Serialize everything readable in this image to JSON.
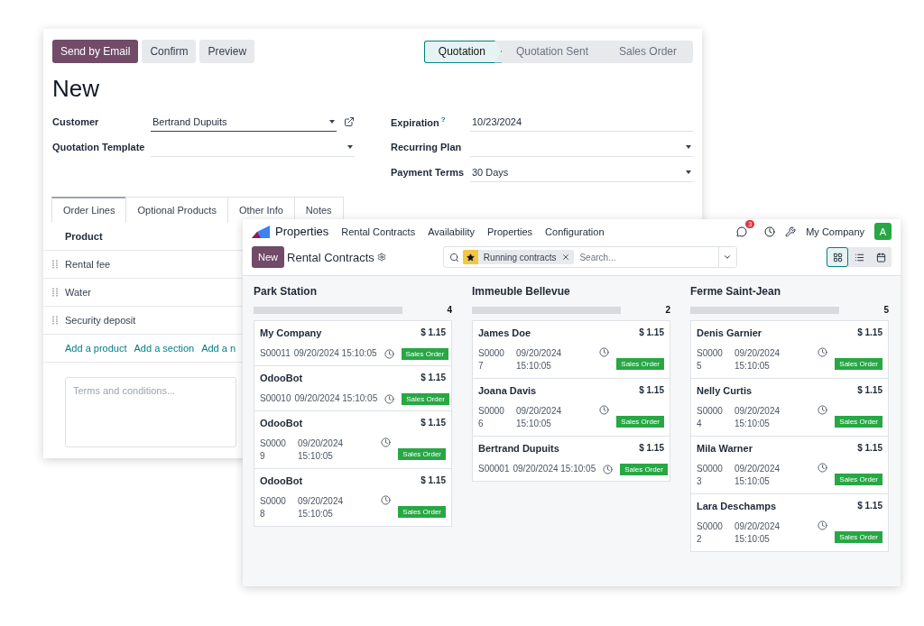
{
  "quotation_window": {
    "actions": [
      "Send by Email",
      "Confirm",
      "Preview"
    ],
    "stages": [
      {
        "label": "Quotation",
        "selected": true
      },
      {
        "label": "Quotation Sent",
        "selected": false
      },
      {
        "label": "Sales Order",
        "selected": false
      }
    ],
    "title": "New",
    "left_fields": [
      {
        "label": "Customer",
        "value": "Bertrand Dupuits",
        "kind": "many2one",
        "focused": true
      },
      {
        "label": "Quotation Template",
        "kind": "select",
        "focused": false
      }
    ],
    "right_fields": [
      {
        "label": "Expiration",
        "help": "?",
        "value": "10/23/2024",
        "kind": "date",
        "focused": false
      },
      {
        "label": "Recurring Plan",
        "kind": "select",
        "focused": false
      },
      {
        "label": "Payment Terms",
        "value": "30 Days",
        "kind": "select",
        "focused": false
      }
    ],
    "tabs": [
      {
        "label": "Order Lines",
        "selected": true
      },
      {
        "label": "Optional Products",
        "selected": false
      },
      {
        "label": "Other Info",
        "selected": false
      },
      {
        "label": "Notes",
        "selected": false
      }
    ],
    "table": {
      "column_header": "Product",
      "rows": [
        "Rental fee",
        "Water",
        "Security deposit"
      ],
      "add_links": [
        "Add a product",
        "Add a section",
        "Add a n"
      ]
    },
    "terms": {
      "placeholder": "Terms and conditions..."
    }
  },
  "kanban_window": {
    "app_name": "Properties",
    "menu": [
      "Rental Contracts",
      "Availability",
      "Properties",
      "Configuration"
    ],
    "messages_badge": "3",
    "company": "My Company",
    "avatar": "A",
    "new_button": "New",
    "breadcrumb": "Rental Contracts",
    "facet": "Running contracts",
    "search": {
      "placeholder": "Search..."
    },
    "views": [
      {
        "kind": "kanban",
        "selected": true
      },
      {
        "kind": "list",
        "selected": false
      },
      {
        "kind": "calendar",
        "selected": false
      }
    ],
    "columns": [
      {
        "title": "Park Station",
        "count": "4",
        "level": 0,
        "cards": [
          {
            "name": "My Company",
            "price": "$ 1.15",
            "ref": "S00011",
            "date": "09/20/2024 15:10:05",
            "status": "Sales Order",
            "wrapped": false
          },
          {
            "name": "OdooBot",
            "price": "$ 1.15",
            "ref": "S00010",
            "date": "09/20/2024 15:10:05",
            "status": "Sales Order",
            "wrapped": false
          },
          {
            "name": "OdooBot",
            "price": "$ 1.15",
            "ref": "S00009",
            "date": "09/20/2024 15:10:05",
            "status": "Sales Order",
            "wrapped": true
          },
          {
            "name": "OdooBot",
            "price": "$ 1.15",
            "ref": "S00008",
            "date": "09/20/2024 15:10:05",
            "status": "Sales Order",
            "wrapped": true
          }
        ]
      },
      {
        "title": "Immeuble Bellevue",
        "count": "2",
        "level": 0,
        "cards": [
          {
            "name": "James Doe",
            "price": "$ 1.15",
            "ref": "S00007",
            "date": "09/20/2024 15:10:05",
            "status": "Sales Order",
            "wrapped": true
          },
          {
            "name": "Joana Davis",
            "price": "$ 1.15",
            "ref": "S00006",
            "date": "09/20/2024 15:10:05",
            "status": "Sales Order",
            "wrapped": true
          },
          {
            "name": "Bertrand Dupuits",
            "price": "$ 1.15",
            "ref": "S00001",
            "date": "09/20/2024 15:10:05",
            "status": "Sales Order",
            "wrapped": false
          }
        ]
      },
      {
        "title": "Ferme Saint-Jean",
        "count": "5",
        "level": 0,
        "cards": [
          {
            "name": "Denis Garnier",
            "price": "$ 1.15",
            "ref": "S00005",
            "date": "09/20/2024 15:10:05",
            "status": "Sales Order",
            "wrapped": true
          },
          {
            "name": "Nelly Curtis",
            "price": "$ 1.15",
            "ref": "S00004",
            "date": "09/20/2024 15:10:05",
            "status": "Sales Order",
            "wrapped": true
          },
          {
            "name": "Mila Warner",
            "price": "$ 1.15",
            "ref": "S00003",
            "date": "09/20/2024 15:10:05",
            "status": "Sales Order",
            "wrapped": true
          },
          {
            "name": "Lara Deschamps",
            "price": "$ 1.15",
            "ref": "S00002",
            "date": "09/20/2024 15:10:05",
            "status": "Sales Order",
            "wrapped": true
          }
        ]
      }
    ]
  }
}
